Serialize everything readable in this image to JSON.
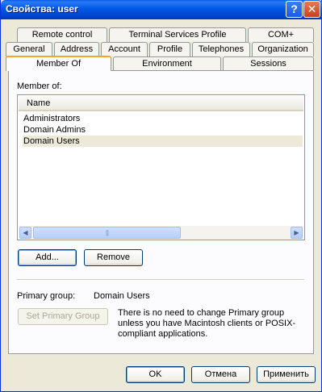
{
  "window": {
    "title": "Свойства: user",
    "help_label": "?",
    "close_label": "✕"
  },
  "tabs": {
    "row1": [
      "Remote control",
      "Terminal Services Profile",
      "COM+"
    ],
    "row2": [
      "General",
      "Address",
      "Account",
      "Profile",
      "Telephones",
      "Organization"
    ],
    "row3": [
      "Member Of",
      "Environment",
      "Sessions"
    ],
    "active": "Member Of"
  },
  "member_of": {
    "label": "Member of:",
    "column_header": "Name",
    "items": [
      "Administrators",
      "Domain Admins",
      "Domain Users"
    ],
    "selected_index": 2
  },
  "scrollbar": {
    "left_arrow": "◀",
    "right_arrow": "▶",
    "thumb_grip": "|||"
  },
  "buttons": {
    "add": "Add...",
    "remove": "Remove",
    "set_primary_group": "Set Primary Group",
    "ok": "OK",
    "cancel": "Отмена",
    "apply": "Применить"
  },
  "primary_group": {
    "label": "Primary group:",
    "value": "Domain Users",
    "note": "There is no need to change Primary group unless you have Macintosh clients or POSIX-compliant applications."
  }
}
